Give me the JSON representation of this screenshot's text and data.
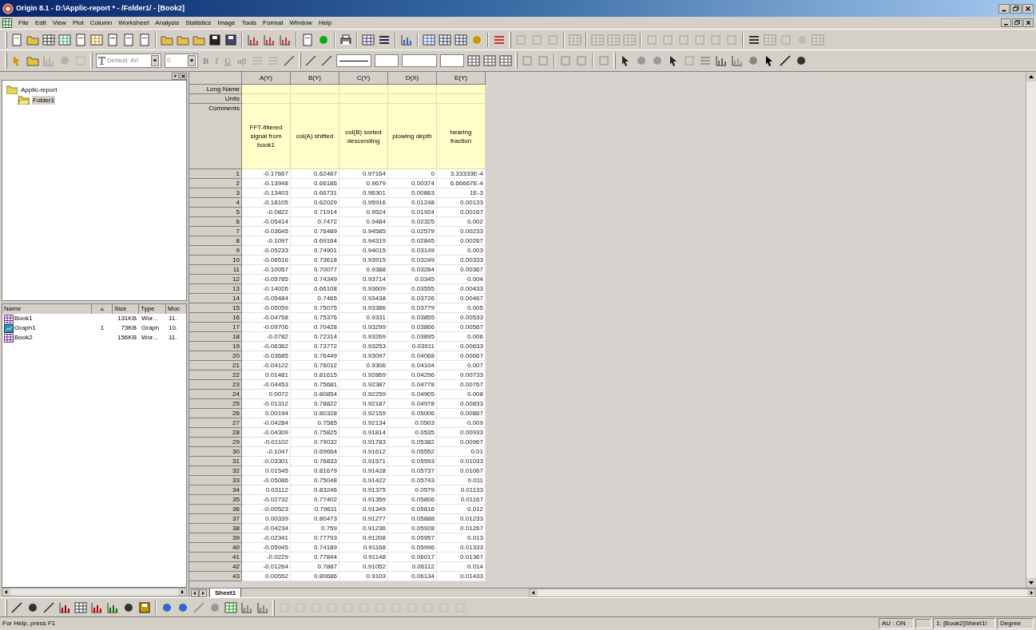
{
  "window": {
    "title": "Origin 8.1 - D:\\Applic-report * - /Folder1/ - [Book2]"
  },
  "menu": [
    "File",
    "Edit",
    "View",
    "Plot",
    "Column",
    "Worksheet",
    "Analysis",
    "Statistics",
    "Image",
    "Tools",
    "Format",
    "Window",
    "Help"
  ],
  "format_toolbar": {
    "font": "Default: Ari",
    "size": "0",
    "buttons": [
      "B",
      "I",
      "U",
      "αβ"
    ]
  },
  "project_tree": [
    {
      "label": "Applic-report",
      "selected": false,
      "children": [
        {
          "label": "Folder1",
          "selected": true
        }
      ]
    }
  ],
  "file_list": {
    "columns": [
      "Name",
      "Size",
      "Type",
      "Moc"
    ],
    "rows": [
      {
        "name": "Book1",
        "count": null,
        "size": "131KB",
        "type": "Wor...",
        "modified": "11.",
        "kind": "workbook"
      },
      {
        "name": "Graph1",
        "count": "1",
        "size": "73KB",
        "type": "Graph",
        "modified": "10.",
        "kind": "graph"
      },
      {
        "name": "Book2",
        "count": null,
        "size": "156KB",
        "type": "Wor...",
        "modified": "11.",
        "kind": "workbook"
      }
    ]
  },
  "worksheet": {
    "label_rows": [
      "Long Name",
      "Units",
      "Comments"
    ],
    "columns": [
      {
        "name": "A(Y)",
        "comment": "FFT-filtered signal from book1"
      },
      {
        "name": "B(Y)",
        "comment": "col(A) shifted"
      },
      {
        "name": "C(Y)",
        "comment": "col(B) sorted descending"
      },
      {
        "name": "D(X)",
        "comment": "plowing depth"
      },
      {
        "name": "E(Y)",
        "comment": "bearing fraction"
      }
    ],
    "rows": [
      {
        "row_number": "1",
        "cells": [
          "-0.17667",
          "0.62467",
          "0.97164",
          "0",
          "3.33333E-4"
        ]
      },
      {
        "row_number": "2",
        "cells": [
          "-0.13948",
          "0.66186",
          "0.9679",
          "0.00374",
          "6.66667E-4"
        ]
      },
      {
        "row_number": "3",
        "cells": [
          "-0.13403",
          "0.66731",
          "0.96301",
          "0.00863",
          "1E-3"
        ]
      },
      {
        "row_number": "4",
        "cells": [
          "-0.18105",
          "0.62029",
          "0.95916",
          "0.01248",
          "0.00133"
        ]
      },
      {
        "row_number": "5",
        "cells": [
          "-0.0822",
          "0.71914",
          "0.9524",
          "0.01924",
          "0.00167"
        ]
      },
      {
        "row_number": "6",
        "cells": [
          "-0.05414",
          "0.7472",
          "0.9484",
          "0.02325",
          "0.002"
        ]
      },
      {
        "row_number": "7",
        "cells": [
          "-0.03645",
          "0.76489",
          "0.94585",
          "0.02579",
          "0.00233"
        ]
      },
      {
        "row_number": "8",
        "cells": [
          "-0.1097",
          "0.69164",
          "0.94319",
          "0.02845",
          "0.00267"
        ]
      },
      {
        "row_number": "9",
        "cells": [
          "-0.05233",
          "0.74901",
          "0.94015",
          "0.03149",
          "0.003"
        ]
      },
      {
        "row_number": "10",
        "cells": [
          "-0.06516",
          "0.73618",
          "0.93915",
          "0.03249",
          "0.00333"
        ]
      },
      {
        "row_number": "11",
        "cells": [
          "-0.10057",
          "0.70077",
          "0.9388",
          "0.03284",
          "0.00367"
        ]
      },
      {
        "row_number": "12",
        "cells": [
          "-0.05785",
          "0.74349",
          "0.93714",
          "0.0345",
          "0.004"
        ]
      },
      {
        "row_number": "13",
        "cells": [
          "-0.14026",
          "0.66108",
          "0.93609",
          "0.03555",
          "0.00433"
        ]
      },
      {
        "row_number": "14",
        "cells": [
          "-0.05484",
          "0.7465",
          "0.93438",
          "0.03726",
          "0.00467"
        ]
      },
      {
        "row_number": "15",
        "cells": [
          "-0.05059",
          "0.75075",
          "0.93386",
          "0.03779",
          "0.005"
        ]
      },
      {
        "row_number": "16",
        "cells": [
          "-0.04758",
          "0.75376",
          "0.9331",
          "0.03855",
          "0.00533"
        ]
      },
      {
        "row_number": "17",
        "cells": [
          "-0.09706",
          "0.70428",
          "0.93299",
          "0.03866",
          "0.00567"
        ]
      },
      {
        "row_number": "18",
        "cells": [
          "-0.0782",
          "0.72314",
          "0.93269",
          "0.03895",
          "0.006"
        ]
      },
      {
        "row_number": "19",
        "cells": [
          "-0.06362",
          "0.73772",
          "0.93253",
          "0.03911",
          "0.00633"
        ]
      },
      {
        "row_number": "20",
        "cells": [
          "-0.03685",
          "0.76449",
          "0.93097",
          "0.04068",
          "0.00667"
        ]
      },
      {
        "row_number": "21",
        "cells": [
          "-0.04122",
          "0.76012",
          "0.9306",
          "0.04104",
          "0.007"
        ]
      },
      {
        "row_number": "22",
        "cells": [
          "0.01481",
          "0.81615",
          "0.92869",
          "0.04296",
          "0.00733"
        ]
      },
      {
        "row_number": "23",
        "cells": [
          "-0.04453",
          "0.75681",
          "0.92387",
          "0.04778",
          "0.00767"
        ]
      },
      {
        "row_number": "24",
        "cells": [
          "0.0072",
          "0.80854",
          "0.92259",
          "0.04905",
          "0.008"
        ]
      },
      {
        "row_number": "25",
        "cells": [
          "-0.01312",
          "0.78822",
          "0.92187",
          "0.04978",
          "0.00833"
        ]
      },
      {
        "row_number": "26",
        "cells": [
          "0.00194",
          "0.80328",
          "0.92159",
          "0.05006",
          "0.00867"
        ]
      },
      {
        "row_number": "27",
        "cells": [
          "-0.04284",
          "0.7585",
          "0.92134",
          "0.0503",
          "0.009"
        ]
      },
      {
        "row_number": "28",
        "cells": [
          "-0.04309",
          "0.75825",
          "0.91814",
          "0.0535",
          "0.00933"
        ]
      },
      {
        "row_number": "29",
        "cells": [
          "-0.01102",
          "0.79032",
          "0.91783",
          "0.05382",
          "0.00967"
        ]
      },
      {
        "row_number": "30",
        "cells": [
          "-0.1047",
          "0.69664",
          "0.91612",
          "0.05552",
          "0.01"
        ]
      },
      {
        "row_number": "31",
        "cells": [
          "-0.03301",
          "0.76833",
          "0.91571",
          "0.05593",
          "0.01033"
        ]
      },
      {
        "row_number": "32",
        "cells": [
          "0.01545",
          "0.81679",
          "0.91428",
          "0.05737",
          "0.01067"
        ]
      },
      {
        "row_number": "33",
        "cells": [
          "-0.05086",
          "0.75048",
          "0.91422",
          "0.05743",
          "0.011"
        ]
      },
      {
        "row_number": "34",
        "cells": [
          "0.03112",
          "0.83246",
          "0.91375",
          "0.0579",
          "0.01133"
        ]
      },
      {
        "row_number": "35",
        "cells": [
          "-0.02732",
          "0.77402",
          "0.91359",
          "0.05806",
          "0.01167"
        ]
      },
      {
        "row_number": "36",
        "cells": [
          "-0.00523",
          "0.79611",
          "0.91349",
          "0.05816",
          "0.012"
        ]
      },
      {
        "row_number": "37",
        "cells": [
          "0.00339",
          "0.80473",
          "0.91277",
          "0.05888",
          "0.01233"
        ]
      },
      {
        "row_number": "38",
        "cells": [
          "-0.04234",
          "0.759",
          "0.91236",
          "0.05928",
          "0.01267"
        ]
      },
      {
        "row_number": "39",
        "cells": [
          "-0.02341",
          "0.77793",
          "0.91208",
          "0.05957",
          "0.013"
        ]
      },
      {
        "row_number": "40",
        "cells": [
          "-0.05945",
          "0.74189",
          "0.91168",
          "0.05996",
          "0.01333"
        ]
      },
      {
        "row_number": "41",
        "cells": [
          "-0.0229",
          "0.77844",
          "0.91148",
          "0.06017",
          "0.01367"
        ]
      },
      {
        "row_number": "42",
        "cells": [
          "-0.01264",
          "0.7887",
          "0.91052",
          "0.06112",
          "0.014"
        ]
      },
      {
        "row_number": "43",
        "cells": [
          "0.00552",
          "0.80686",
          "0.9103",
          "0.06134",
          "0.01433"
        ]
      }
    ]
  },
  "sheet_tabs": [
    {
      "label": "Sheet1",
      "selected": true
    }
  ],
  "status_bar": {
    "help": "For Help, press F1",
    "au": "AU : ON",
    "active_sheet": "1: [Book2]Sheet1!",
    "angle": "Degree"
  }
}
